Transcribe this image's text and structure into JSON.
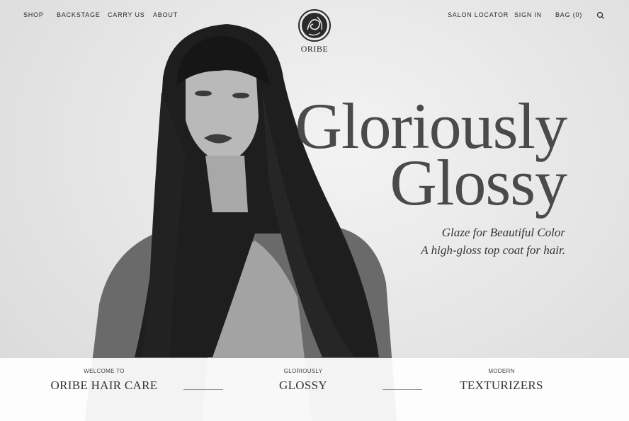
{
  "nav": {
    "left": [
      {
        "label": "SHOP"
      },
      {
        "label": "BACKSTAGE"
      },
      {
        "label": "CARRY US"
      },
      {
        "label": "ABOUT"
      }
    ],
    "right": [
      {
        "label": "SALON LOCATOR"
      },
      {
        "label": "SIGN IN"
      },
      {
        "label": "BAG (0)"
      }
    ],
    "search_icon": "search-icon"
  },
  "logo": {
    "text": "ORIBE"
  },
  "hero": {
    "headline_line1": "Gloriously",
    "headline_line2": "Glossy",
    "subline1": "Glaze for Beautiful Color",
    "subline2": "A high-gloss top coat for hair."
  },
  "categories": [
    {
      "kicker": "WELCOME TO",
      "title": "ORIBE HAIR CARE"
    },
    {
      "kicker": "GLORIOUSLY",
      "title": "GLOSSY"
    },
    {
      "kicker": "MODERN",
      "title": "TEXTURIZERS"
    }
  ]
}
